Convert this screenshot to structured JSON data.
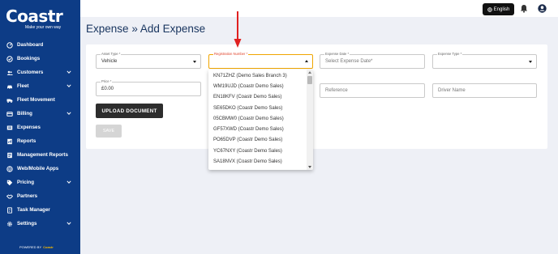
{
  "brand": {
    "logo_text": "Coastr",
    "tagline": "Make your own way",
    "powered_prefix": "POWERED BY",
    "powered_brand": "Coastr"
  },
  "sidebar": {
    "items": [
      {
        "label": "Dashboard",
        "icon": "dashboard-icon",
        "chevron": false
      },
      {
        "label": "Bookings",
        "icon": "bookings-icon",
        "chevron": false
      },
      {
        "label": "Customers",
        "icon": "customers-icon",
        "chevron": true
      },
      {
        "label": "Fleet",
        "icon": "car-icon",
        "chevron": true
      },
      {
        "label": "Fleet Movement",
        "icon": "fleet-movement-icon",
        "chevron": false
      },
      {
        "label": "Billing",
        "icon": "billing-icon",
        "chevron": true
      },
      {
        "label": "Expenses",
        "icon": "expenses-icon",
        "chevron": false
      },
      {
        "label": "Reports",
        "icon": "reports-icon",
        "chevron": false
      },
      {
        "label": "Management Reports",
        "icon": "management-reports-icon",
        "chevron": false
      },
      {
        "label": "Web/Mobile Apps",
        "icon": "globe-icon",
        "chevron": false
      },
      {
        "label": "Pricing",
        "icon": "tag-icon",
        "chevron": true
      },
      {
        "label": "Partners",
        "icon": "handshake-icon",
        "chevron": false
      },
      {
        "label": "Task Manager",
        "icon": "task-icon",
        "chevron": false
      },
      {
        "label": "Settings",
        "icon": "gear-icon",
        "chevron": true
      }
    ]
  },
  "header": {
    "language": "English"
  },
  "page": {
    "breadcrumb_parent": "Expense",
    "separator": "»",
    "title": "Add Expense"
  },
  "form": {
    "asset_type": {
      "label": "Asset Type *",
      "value": "Vehicle"
    },
    "registration_number": {
      "label": "Registration Number *",
      "value": ""
    },
    "expense_date": {
      "label": "Expense Date *",
      "placeholder": "Select Expense Date*"
    },
    "expense_type": {
      "label": "Expense Type *",
      "value": ""
    },
    "price": {
      "label": "Price *",
      "value": "£0.00"
    },
    "reference": {
      "placeholder": "Reference"
    },
    "driver_name": {
      "placeholder": "Driver Name"
    },
    "upload_label": "UPLOAD DOCUMENT",
    "save_label": "SAVE"
  },
  "dropdown": {
    "options": [
      "KN71ZHZ (Demo Sales Branch 3)",
      "WM19UJD (Coastr Demo Sales)",
      "EN18KFV (Coastr Demo Sales)",
      "SE65DKO (Coastr Demo Sales)",
      "05CBMW0 (Coastr Demo Sales)",
      "GF57XWD (Coastr Demo Sales)",
      "PO65DVP (Coastr Demo Sales)",
      "YC67NXY (Coastr Demo Sales)",
      "SA18NVX (Coastr Demo Sales)"
    ]
  },
  "colors": {
    "sidebar": "#0d3c86",
    "accent_border": "#f0a500",
    "annotation_arrow": "#e02020"
  }
}
